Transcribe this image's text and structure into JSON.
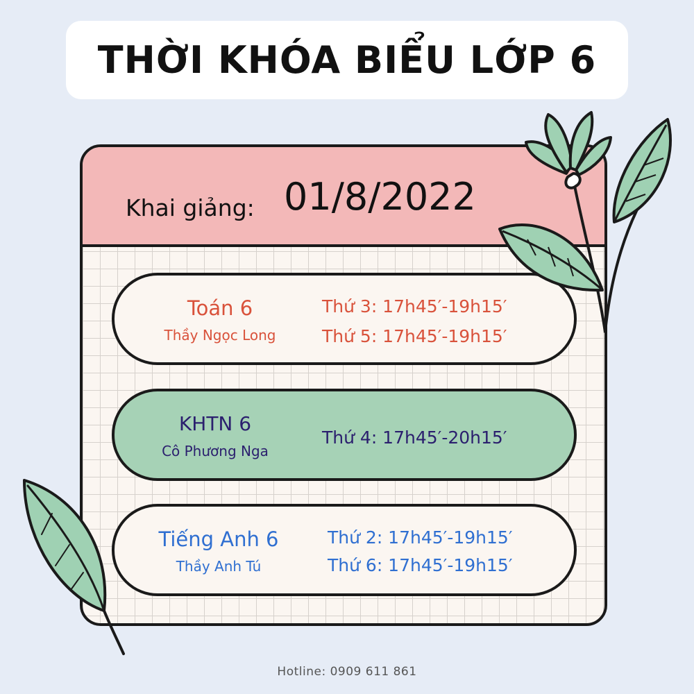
{
  "title": "THỜI KHÓA BIỂU LỚP 6",
  "opening": {
    "label": "Khai giảng:",
    "date": "01/8/2022"
  },
  "classes": [
    {
      "subject": "Toán 6",
      "teacher": "Thầy Ngọc Long",
      "schedule": [
        "Thứ 3: 17h45′-19h15′",
        "Thứ 5: 17h45′-19h15′"
      ],
      "color": "#d9523b",
      "background": "#fbf6f1"
    },
    {
      "subject": "KHTN 6",
      "teacher": "Cô Phương Nga",
      "schedule": [
        "Thứ 4: 17h45′-20h15′"
      ],
      "color": "#2b1f6e",
      "background": "#a6d2b6"
    },
    {
      "subject": "Tiếng Anh 6",
      "teacher": "Thầy Anh Tú",
      "schedule": [
        "Thứ 2: 17h45′-19h15′",
        "Thứ 6: 17h45′-19h15′"
      ],
      "color": "#2f6fd1",
      "background": "#fbf6f1"
    }
  ],
  "hotline": "Hotline: 0909 611 861",
  "colors": {
    "background": "#e6ecf6",
    "header": "#f3b8b8",
    "leaf": "#9fd1b3",
    "outline": "#1a1a1a"
  },
  "decorations": [
    "leaf-icon",
    "flower-icon"
  ]
}
